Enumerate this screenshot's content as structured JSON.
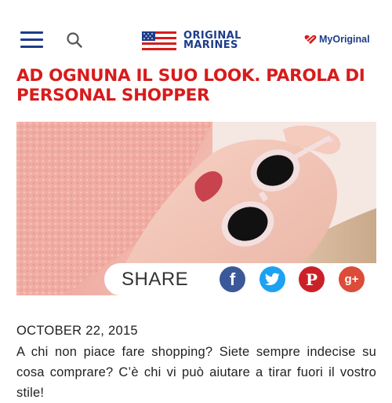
{
  "header": {
    "menu_icon": "hamburger-menu-icon",
    "search_icon": "search-icon",
    "logo": {
      "line1": "ORIGINAL",
      "line2": "MARINES",
      "flag_icon": "us-flag-icon"
    },
    "account": {
      "label": "MyOriginal",
      "icon": "heart-icon"
    }
  },
  "article": {
    "title": "AD OGNUNA IL SUO LOOK. PAROLA DI PERSONAL SHOPPER",
    "date": "OCTOBER 22, 2015",
    "body": "A chi non piace fare shopping? Siete sempre indecise su cosa comprare? C’è chi vi può aiutare a tirar fuori il vostro stile!"
  },
  "share": {
    "label": "SHARE",
    "buttons": [
      {
        "name": "facebook",
        "glyph": "f",
        "color": "#3b5998"
      },
      {
        "name": "twitter",
        "glyph": "t",
        "color": "#1da1f2"
      },
      {
        "name": "pinterest",
        "glyph": "P",
        "color": "#cb2027"
      },
      {
        "name": "google-plus",
        "glyph": "g+",
        "color": "#dd4b39"
      }
    ]
  },
  "colors": {
    "brand_blue": "#1d3c8a",
    "title_red": "#d81b1b"
  }
}
